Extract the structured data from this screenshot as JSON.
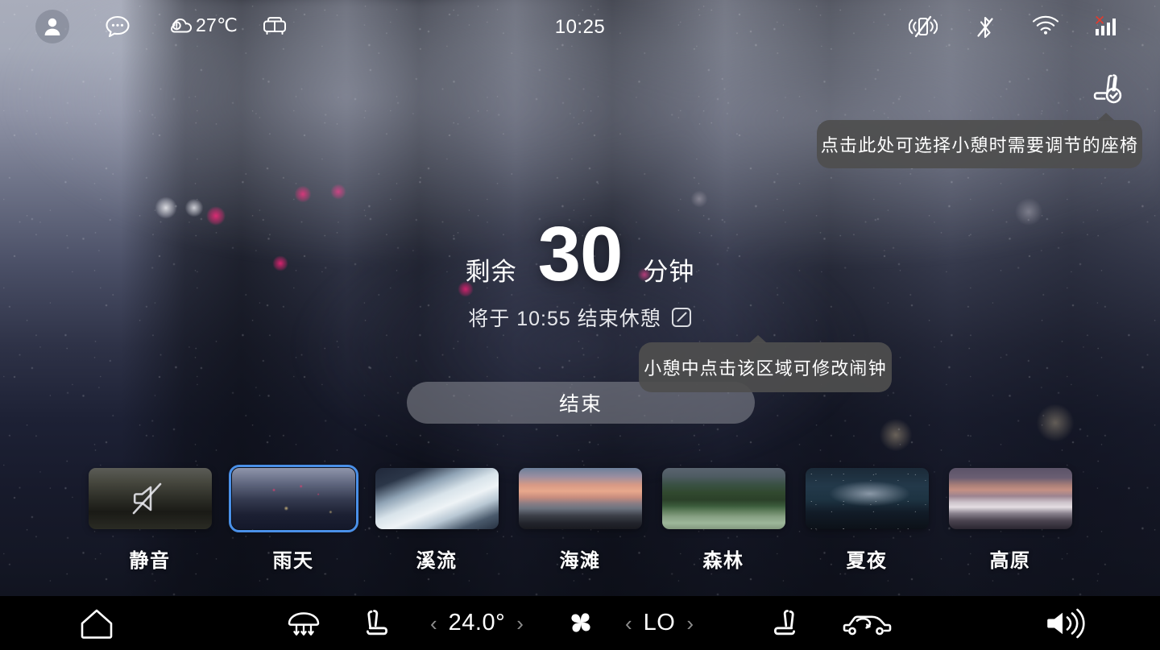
{
  "statusbar": {
    "avatar_icon": "user-avatar-icon",
    "message_icon": "chat-bubble-icon",
    "weather_icon": "cloud-warning-icon",
    "temperature": "27℃",
    "rest_icon": "sofa-icon",
    "clock": "10:25",
    "vibrate_icon": "vibrate-off-icon",
    "bluetooth_icon": "bluetooth-off-icon",
    "wifi_icon": "wifi-icon",
    "signal_icon": "cellular-signal-icon",
    "signal_error_mark": "✕"
  },
  "seat_select": {
    "icon": "seat-check-icon",
    "tooltip": "点击此处可选择小憩时需要调节的座椅"
  },
  "timer": {
    "prefix_label": "剩余",
    "value": "30",
    "unit_label": "分钟",
    "alarm_text": "将于 10:55 结束休憩",
    "edit_icon": "edit-square-icon",
    "alarm_tooltip": "小憩中点击该区域可修改闹钟"
  },
  "end_button": {
    "label": "结束"
  },
  "scenes": {
    "items": [
      {
        "label": "静音",
        "art": "t-mute",
        "icon": "speaker-mute-icon",
        "selected": false
      },
      {
        "label": "雨天",
        "art": "t-rain",
        "icon": "",
        "selected": true
      },
      {
        "label": "溪流",
        "art": "t-stream",
        "icon": "",
        "selected": false
      },
      {
        "label": "海滩",
        "art": "t-beach",
        "icon": "",
        "selected": false
      },
      {
        "label": "森林",
        "art": "t-forest",
        "icon": "",
        "selected": false
      },
      {
        "label": "夏夜",
        "art": "t-summer",
        "icon": "",
        "selected": false
      },
      {
        "label": "高原",
        "art": "t-plateau",
        "icon": "",
        "selected": false
      }
    ]
  },
  "bottombar": {
    "home_icon": "home-icon",
    "rear_defrost_icon": "rear-defrost-icon",
    "driver_seat_heat_icon": "driver-seat-icon",
    "temp_prev_chevron": "‹",
    "temperature": "24.0°",
    "temp_next_chevron": "›",
    "fan_icon": "fan-icon",
    "fan_prev_chevron": "‹",
    "fan_speed": "LO",
    "fan_next_chevron": "›",
    "passenger_seat_heat_icon": "passenger-seat-icon",
    "recirculation_icon": "air-recirculation-icon",
    "volume_icon": "volume-icon"
  },
  "colors": {
    "accent_selected": "#4a90e8",
    "tooltip_bg": "#4e4e4e",
    "signal_error": "#e33b2e",
    "bottombar_bg": "#000000"
  }
}
